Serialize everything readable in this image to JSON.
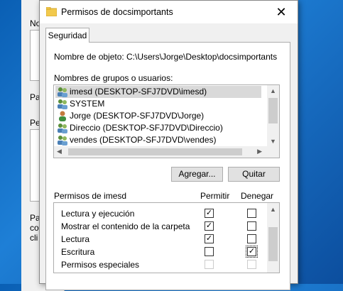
{
  "background_window": {
    "fragments": [
      "No",
      "Pa",
      "Pe",
      "Pa",
      "co",
      "cli"
    ]
  },
  "dialog": {
    "title": "Permisos de docsimportants",
    "close_glyph": "✕",
    "tab": "Seguridad",
    "object_label": "Nombre de objeto:",
    "object_path": "C:\\Users\\Jorge\\Desktop\\docsimportants",
    "groups_label": "Nombres de grupos o usuarios:",
    "users": [
      {
        "name": "imesd (DESKTOP-SFJ7DVD\\imesd)",
        "icon": "group-icon",
        "selected": true
      },
      {
        "name": "SYSTEM",
        "icon": "group-icon",
        "selected": false
      },
      {
        "name": "Jorge (DESKTOP-SFJ7DVD\\Jorge)",
        "icon": "user-icon",
        "selected": false
      },
      {
        "name": "Direccio (DESKTOP-SFJ7DVD\\Direccio)",
        "icon": "group-icon",
        "selected": false
      },
      {
        "name": "vendes (DESKTOP-SFJ7DVD\\vendes)",
        "icon": "group-icon",
        "selected": false
      }
    ],
    "add_button": "Agregar...",
    "remove_button": "Quitar",
    "permissions_label": "Permisos de imesd",
    "allow_header": "Permitir",
    "deny_header": "Denegar",
    "permissions": [
      {
        "name": "Lectura y ejecución",
        "allow": true,
        "deny": false,
        "disabled": false
      },
      {
        "name": "Mostrar el contenido de la carpeta",
        "allow": true,
        "deny": false,
        "disabled": false
      },
      {
        "name": "Lectura",
        "allow": true,
        "deny": false,
        "disabled": false
      },
      {
        "name": "Escritura",
        "allow": false,
        "deny": true,
        "disabled": false
      },
      {
        "name": "Permisos especiales",
        "allow": false,
        "deny": false,
        "disabled": true
      }
    ]
  },
  "colors": {
    "desktop": "#0a5fb4",
    "dialog_bg": "#f0f0f0",
    "selection": "#d9d9d9"
  }
}
